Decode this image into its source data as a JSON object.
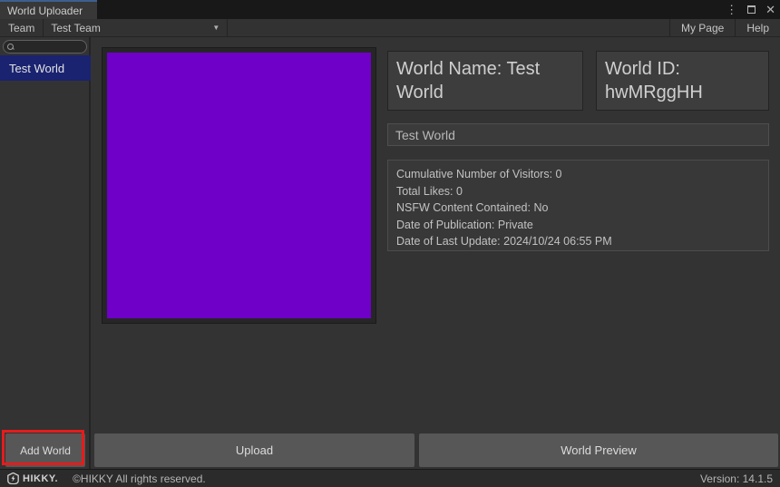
{
  "window": {
    "tab_title": "World Uploader"
  },
  "toolbar": {
    "team_label": "Team",
    "team_selected": "Test Team",
    "my_page_label": "My Page",
    "help_label": "Help"
  },
  "sidebar": {
    "items": [
      {
        "label": "Test World",
        "selected": true
      }
    ]
  },
  "world": {
    "name_header": "World Name: Test World",
    "id_header": "World ID: hwMRggHH",
    "name_field_value": "Test World",
    "stats": [
      "Cumulative Number of Visitors: 0",
      "Total Likes: 0",
      "NSFW Content Contained: No",
      "Date of Publication: Private",
      "Date of Last Update: 2024/10/24 06:55 PM"
    ],
    "thumbnail_color": "#6E00C8"
  },
  "actions": {
    "add_world": "Add World",
    "upload": "Upload",
    "world_preview": "World Preview"
  },
  "statusbar": {
    "brand": "HIKKY.",
    "copyright": "©HIKKY All rights reserved.",
    "version": "Version: 14.1.5"
  },
  "colors": {
    "selection_blue": "#1a2370",
    "highlight_red": "#e51c1c",
    "tab_accent": "#3e5f8f"
  }
}
